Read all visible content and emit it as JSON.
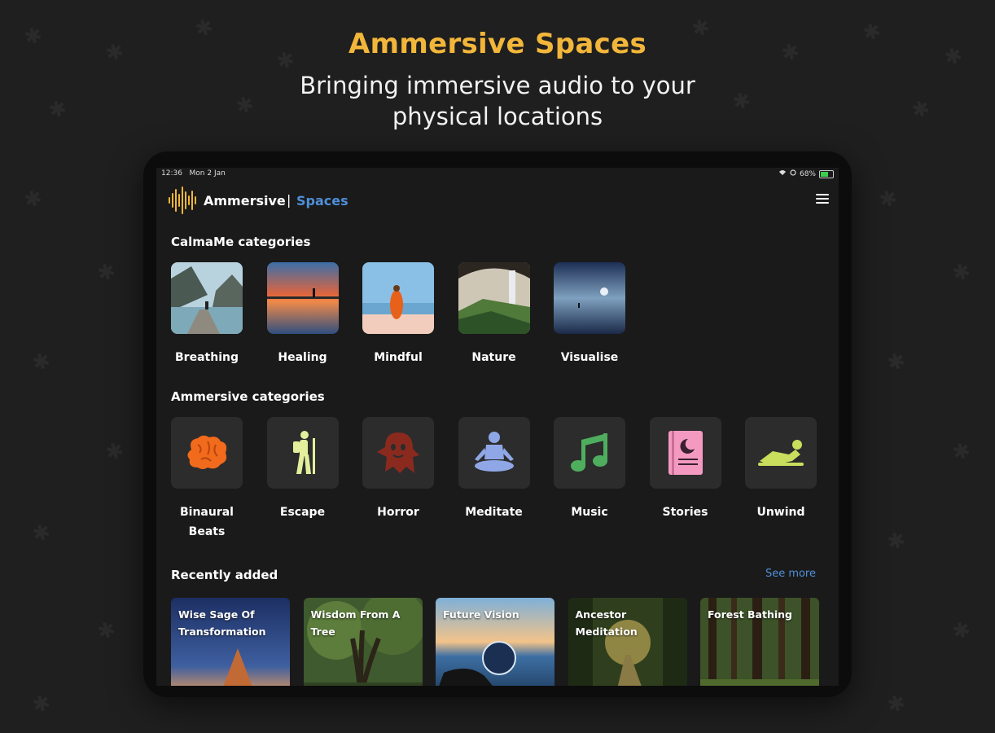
{
  "hero": {
    "title": "Ammersive Spaces",
    "subtitle_line1": "Bringing immersive audio to your",
    "subtitle_line2": "physical locations"
  },
  "status_bar": {
    "time": "12:36",
    "date": "Mon 2 Jan",
    "battery": "68%"
  },
  "header": {
    "brand": "Ammersive",
    "separator": "|",
    "section": "Spaces"
  },
  "calmame": {
    "title": "CalmaMe categories",
    "items": [
      {
        "label": "Breathing"
      },
      {
        "label": "Healing"
      },
      {
        "label": "Mindful"
      },
      {
        "label": "Nature"
      },
      {
        "label": "Visualise"
      }
    ]
  },
  "ammersive": {
    "title": "Ammersive categories",
    "items": [
      {
        "label_line1": "Binaural",
        "label_line2": "Beats",
        "icon": "brain-icon",
        "color": "#f26a1b"
      },
      {
        "label_line1": "Escape",
        "label_line2": "",
        "icon": "hiker-icon",
        "color": "#e4ef9c"
      },
      {
        "label_line1": "Horror",
        "label_line2": "",
        "icon": "ghost-icon",
        "color": "#8a2a1e"
      },
      {
        "label_line1": "Meditate",
        "label_line2": "",
        "icon": "meditate-icon",
        "color": "#8fa7e6"
      },
      {
        "label_line1": "Music",
        "label_line2": "",
        "icon": "music-note-icon",
        "color": "#4fae5e"
      },
      {
        "label_line1": "Stories",
        "label_line2": "",
        "icon": "storybook-icon",
        "color": "#f49ac1"
      },
      {
        "label_line1": "Unwind",
        "label_line2": "",
        "icon": "relax-icon",
        "color": "#c9de5c"
      }
    ]
  },
  "recent": {
    "title": "Recently added",
    "see_more": "See more",
    "items": [
      {
        "title": "Wise Sage Of Transformation"
      },
      {
        "title": "Wisdom From A Tree"
      },
      {
        "title": "Future Vision"
      },
      {
        "title": "Ancestor Meditation"
      },
      {
        "title": "Forest Bathing"
      }
    ]
  },
  "colors": {
    "accent_gold": "#f2b63a",
    "accent_blue": "#4f8fd8",
    "background": "#1f1f1f"
  }
}
